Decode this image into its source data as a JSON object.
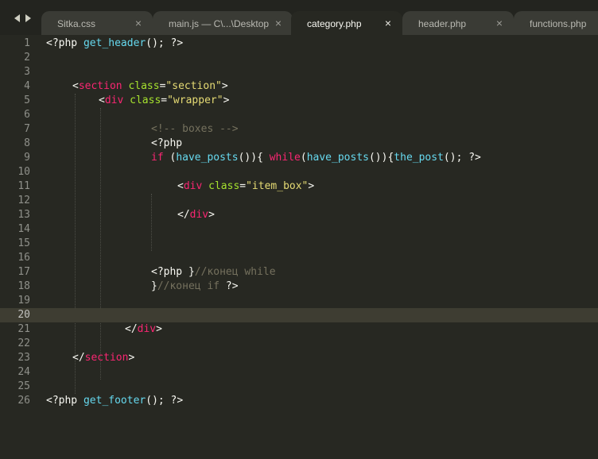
{
  "tabs": [
    {
      "label": "Sitka.css",
      "close": "×",
      "active": false
    },
    {
      "label": "main.js — C\\...\\Desktop",
      "close": "×",
      "active": false
    },
    {
      "label": "category.php",
      "close": "×",
      "active": true
    },
    {
      "label": "header.php",
      "close": "×",
      "active": false
    },
    {
      "label": "functions.php",
      "close": "",
      "active": false
    }
  ],
  "colors": {
    "background": "#272822",
    "tag": "#f92672",
    "attribute": "#a6e22e",
    "string": "#e6db74",
    "function": "#66d9ef",
    "comment": "#75715e",
    "plain": "#f8f8f2"
  },
  "editor": {
    "current_line": 20,
    "lines": [
      {
        "n": "1",
        "t1": "<?php ",
        "t2": "get_header",
        "t3": "(); ?>"
      },
      {
        "n": "2"
      },
      {
        "n": "3"
      },
      {
        "n": "4",
        "t1": "<",
        "t2": "section",
        "t3": " ",
        "t4": "class",
        "t5": "=",
        "t6": "\"section\"",
        "t7": ">"
      },
      {
        "n": "5",
        "t1": "<",
        "t2": "div",
        "t3": " ",
        "t4": "class",
        "t5": "=",
        "t6": "\"wrapper\"",
        "t7": ">"
      },
      {
        "n": "6"
      },
      {
        "n": "7",
        "t1": "<!-- boxes -->"
      },
      {
        "n": "8",
        "t1": "<?php"
      },
      {
        "n": "9",
        "t1": "if",
        "t2": " (",
        "t3": "have_posts",
        "t4": "()){ ",
        "t5": "while",
        "t6": "(",
        "t7": "have_posts",
        "t8": "()){",
        "t9": "the_post",
        "t10": "(); ?>"
      },
      {
        "n": "10"
      },
      {
        "n": "11",
        "t1": "<",
        "t2": "div",
        "t3": " ",
        "t4": "class",
        "t5": "=",
        "t6": "\"item_box\"",
        "t7": ">"
      },
      {
        "n": "12"
      },
      {
        "n": "13",
        "t1": "</",
        "t2": "div",
        "t3": ">"
      },
      {
        "n": "14"
      },
      {
        "n": "15"
      },
      {
        "n": "16"
      },
      {
        "n": "17",
        "t1": "<?php }",
        "t2": "//конец while"
      },
      {
        "n": "18",
        "t1": "}",
        "t2": "//конец if",
        "t3": " ?>"
      },
      {
        "n": "19"
      },
      {
        "n": "20"
      },
      {
        "n": "21",
        "t1": "</",
        "t2": "div",
        "t3": ">"
      },
      {
        "n": "22"
      },
      {
        "n": "23",
        "t1": "</",
        "t2": "section",
        "t3": ">"
      },
      {
        "n": "24"
      },
      {
        "n": "25"
      },
      {
        "n": "26",
        "t1": "<?php ",
        "t2": "get_footer",
        "t3": "(); ?>"
      }
    ]
  }
}
